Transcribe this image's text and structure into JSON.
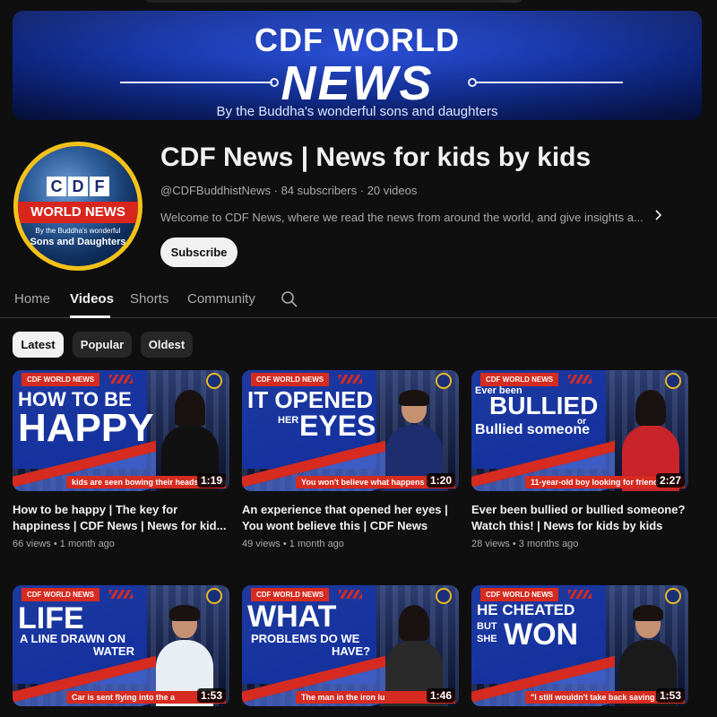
{
  "banner": {
    "line1": "CDF WORLD",
    "line2": "NEWS",
    "tagline": "By the Buddha's wonderful sons and daughters"
  },
  "avatar": {
    "letters": [
      "C",
      "D",
      "F"
    ],
    "band": "WORLD NEWS",
    "sub1": "By the Buddha's wonderful",
    "sub2": "Sons and Daughters"
  },
  "channel": {
    "title": "CDF News | News for kids by kids",
    "handle": "@CDFBuddhistNews",
    "subscribers": "84 subscribers",
    "videos_count": "20 videos",
    "separator": " · ",
    "description": "Welcome to CDF News, where we read the news from around the world, and give insights a...",
    "subscribe_label": "Subscribe"
  },
  "tabs": [
    {
      "label": "Home",
      "active": false
    },
    {
      "label": "Videos",
      "active": true
    },
    {
      "label": "Shorts",
      "active": false
    },
    {
      "label": "Community",
      "active": false
    }
  ],
  "chips": [
    {
      "label": "Latest",
      "selected": true
    },
    {
      "label": "Popular",
      "selected": false
    },
    {
      "label": "Oldest",
      "selected": false
    }
  ],
  "videos": [
    {
      "thumb_tag": "CDF WORLD NEWS",
      "thumb_line1": "HOW TO BE",
      "thumb_line2": "HAPPY",
      "thumb_caption": "kids are seen bowing their heads as a thank",
      "duration": "1:19",
      "title": "How to be happy | The key for happiness | CDF News | News for kid...",
      "views": "66 views",
      "age": "1 month ago"
    },
    {
      "thumb_tag": "CDF WORLD NEWS",
      "thumb_line1": "IT OPENED",
      "thumb_line_small": "HER",
      "thumb_line2": "EYES",
      "thumb_caption": "You won't believe what happens t",
      "duration": "1:20",
      "title": "An experience that opened her eyes | You wont believe this | CDF News",
      "views": "49 views",
      "age": "1 month ago"
    },
    {
      "thumb_tag": "CDF WORLD NEWS",
      "thumb_line_small": "Ever been",
      "thumb_line1": "BULLIED",
      "thumb_line_or": "or",
      "thumb_line2": "Bullied someone",
      "thumb_caption": "11-year-old boy looking for friend",
      "duration": "2:27",
      "title": "Ever been bullied or bullied someone? Watch this! | News for kids by kids",
      "views": "28 views",
      "age": "3 months ago"
    },
    {
      "thumb_tag": "CDF WORLD NEWS",
      "thumb_line1": "LIFE",
      "thumb_line2": "A LINE DRAWN ON",
      "thumb_line3": "WATER",
      "thumb_caption": "Car is sent flying into the a",
      "duration": "1:53"
    },
    {
      "thumb_tag": "CDF WORLD NEWS",
      "thumb_line1": "WHAT",
      "thumb_line2": "PROBLEMS DO WE",
      "thumb_line3": "HAVE?",
      "thumb_caption": "The man in the iron lu",
      "duration": "1:46"
    },
    {
      "thumb_tag": "CDF WORLD NEWS",
      "thumb_line1": "HE CHEATED",
      "thumb_line_small": "BUT",
      "thumb_line_small2": "SHE",
      "thumb_line2": "WON",
      "thumb_caption": "\"I still wouldn't take back saving his",
      "duration": "1:53"
    }
  ],
  "colors": {
    "background": "#0f0f0f",
    "brand_blue": "#1636a8",
    "brand_red": "#d62b20",
    "avatar_ring": "#f3c21a"
  }
}
